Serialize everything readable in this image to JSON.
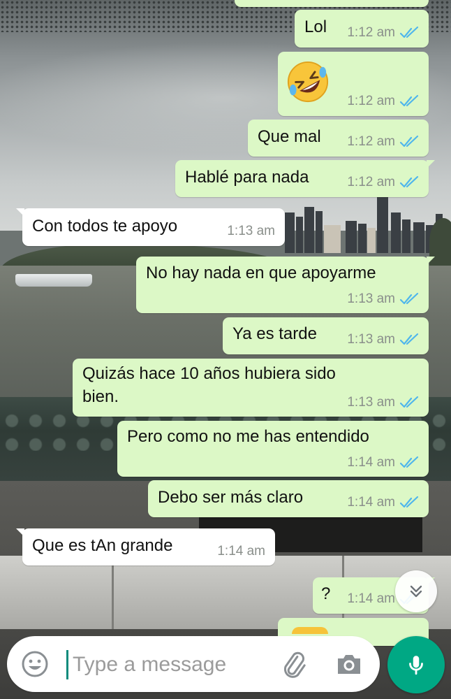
{
  "chat": {
    "messages": [
      {
        "direction": "out",
        "text": "Lol",
        "time": "1:12 am",
        "status": "read"
      },
      {
        "direction": "out",
        "text": "🤣",
        "time": "1:12 am",
        "status": "read",
        "emoji_name": "rolling-on-the-floor-laughing"
      },
      {
        "direction": "out",
        "text": "Que mal",
        "time": "1:12 am",
        "status": "read"
      },
      {
        "direction": "out",
        "text": "Hablé para nada",
        "time": "1:12 am",
        "status": "read"
      },
      {
        "direction": "in",
        "text": "Con todos te apoyo",
        "time": "1:13 am"
      },
      {
        "direction": "out",
        "text": "No hay nada en que apoyarme",
        "time": "1:13 am",
        "status": "read"
      },
      {
        "direction": "out",
        "text": "Ya es tarde",
        "time": "1:13 am",
        "status": "read"
      },
      {
        "direction": "out",
        "lines": [
          "Quizás hace 10 años hubiera sido",
          "bien."
        ],
        "time": "1:13 am",
        "status": "read"
      },
      {
        "direction": "out",
        "text": "Pero como no me has entendido",
        "time": "1:14 am",
        "status": "read"
      },
      {
        "direction": "out",
        "text": "Debo ser más claro",
        "time": "1:14 am",
        "status": "read"
      },
      {
        "direction": "in",
        "text": "Que es tAn grande",
        "time": "1:14 am"
      },
      {
        "direction": "out",
        "text": "?",
        "time": "1:14 am",
        "status": "read"
      }
    ]
  },
  "scroll_button": {
    "icon": "double-chevron-down-icon"
  },
  "composer": {
    "placeholder": "Type a message",
    "value": "",
    "emoji_icon": "emoji-icon",
    "attach_icon": "paperclip-icon",
    "camera_icon": "camera-icon",
    "mic_icon": "microphone-icon"
  },
  "colors": {
    "outgoing_bubble": "#dcf8c6",
    "incoming_bubble": "#ffffff",
    "read_tick": "#4fb6ec",
    "timestamp": "#8a8f8b",
    "accent": "#00a884"
  }
}
